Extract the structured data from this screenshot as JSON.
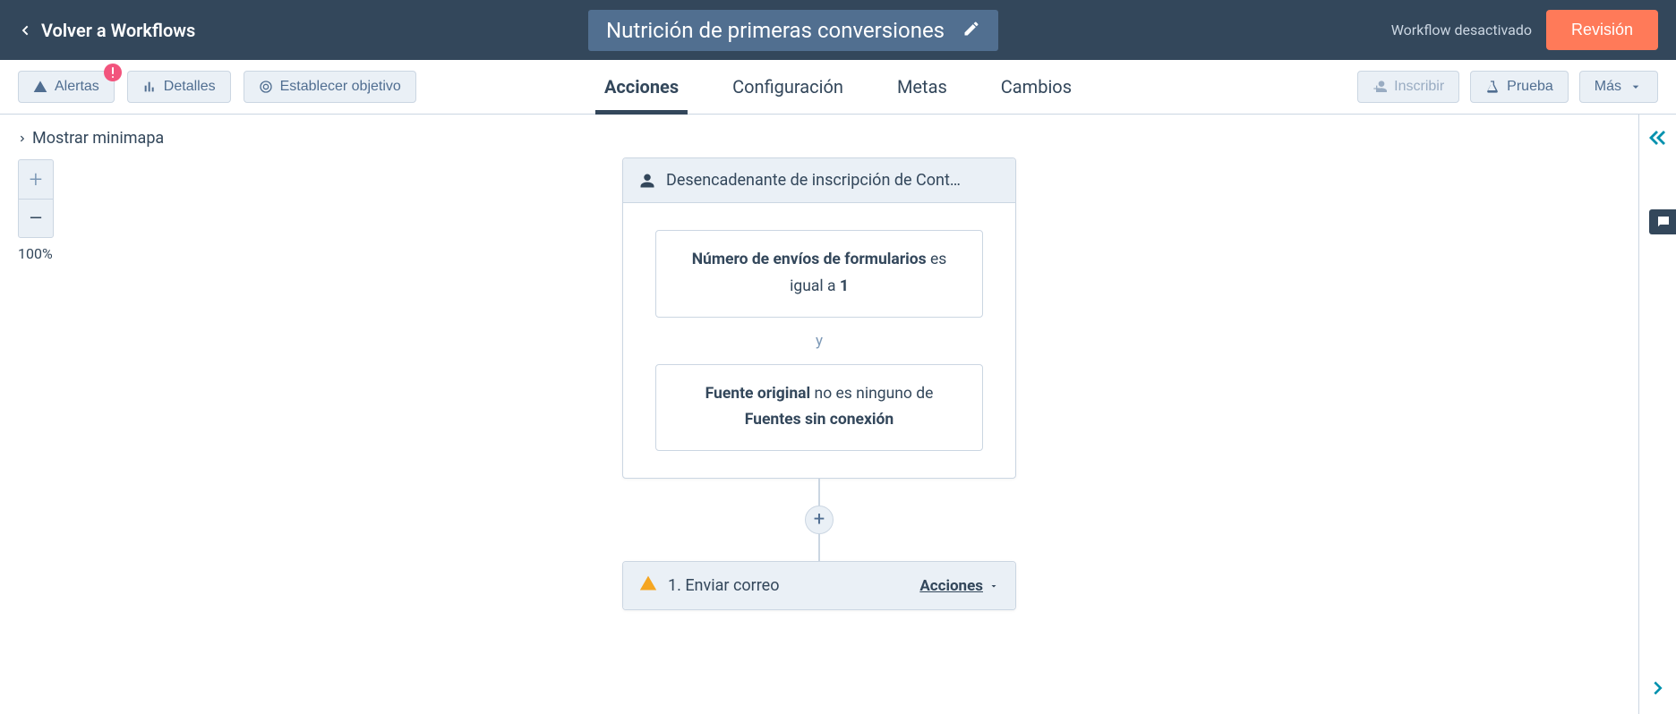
{
  "header": {
    "back_label": "Volver a Workflows",
    "title": "Nutrición de primeras conversiones",
    "status": "Workflow desactivado",
    "review_label": "Revisión"
  },
  "toolbar": {
    "alerts_label": "Alertas",
    "details_label": "Detalles",
    "goal_label": "Establecer objetivo",
    "enroll_label": "Inscribir",
    "test_label": "Prueba",
    "more_label": "Más",
    "tabs": {
      "actions": "Acciones",
      "config": "Configuración",
      "goals": "Metas",
      "changes": "Cambios"
    }
  },
  "canvas": {
    "minimap_label": "Mostrar minimapa",
    "zoom_percent": "100%"
  },
  "trigger": {
    "header": "Desencadenante de inscripción de Cont…",
    "filter1_prop": "Número de envíos de formularios",
    "filter1_mid": " es igual a ",
    "filter1_val": "1",
    "and": "y",
    "filter2_prop": "Fuente original",
    "filter2_mid": " no es ninguno de ",
    "filter2_val": "Fuentes sin conexión"
  },
  "step1": {
    "title": "1. Enviar correo",
    "actions_label": "Acciones"
  }
}
